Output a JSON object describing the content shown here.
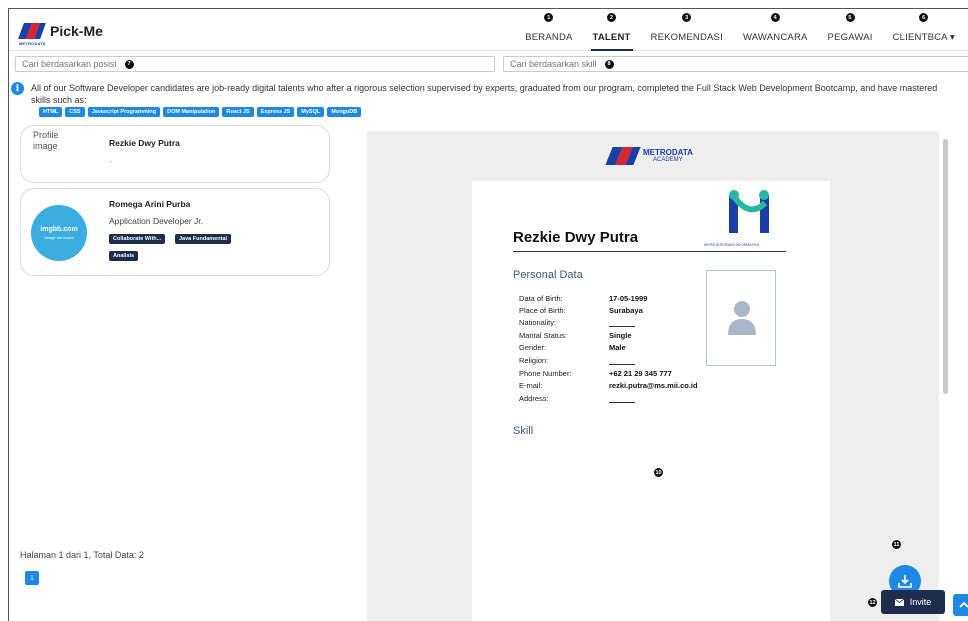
{
  "brand": {
    "name": "Pick-Me",
    "sub": "METRODATA"
  },
  "nav": {
    "items": [
      {
        "num": "1",
        "label": "BERANDA"
      },
      {
        "num": "2",
        "label": "TALENT"
      },
      {
        "num": "3",
        "label": "REKOMENDASI"
      },
      {
        "num": "4",
        "label": "WAWANCARA"
      },
      {
        "num": "5",
        "label": "PEGAWAI"
      },
      {
        "num": "6",
        "label": "CLIENTBCA ▾"
      }
    ]
  },
  "search": {
    "position_placeholder": "Cari berdasarkan posisi",
    "position_num": "7",
    "skill_placeholder": "Cari berdasarkan skill",
    "skill_num": "8"
  },
  "info": {
    "icon": "i",
    "text": "All of our Software Developer candidates are job-ready digital talents who after a rigorous selection supervised by experts, graduated from our program, completed the Full Stack Web Development Bootcamp, and have mastered skills such as:",
    "tags": [
      "HTML",
      "CSS",
      "Javascript Programming",
      "DOM Manipulation",
      "React JS",
      "Express JS",
      "MySQL",
      "MongoDB"
    ]
  },
  "candidates": [
    {
      "image_alt": "Profile image",
      "name": "Rezkie Dwy Putra",
      "role": "-",
      "skills": []
    },
    {
      "image_text": "imgbb.com",
      "image_sub": "Image not found",
      "name": "Romega Arini Purba",
      "role": "Application Developer Jr.",
      "skills": [
        "Collaborate With...",
        "Java Fundamental",
        "Analisis"
      ]
    }
  ],
  "paging": {
    "text": "Halaman 1 dari 1, Total Data: 2",
    "current": "1"
  },
  "markers": {
    "bracket": "9",
    "preview": "10",
    "download": "11",
    "invite": "12"
  },
  "preview": {
    "logo_title": "METRODATA",
    "logo_sub": "ACADEMY",
    "company_caption": "MITRA INTEGRASI INFORMATIKA",
    "cv_name": "Rezkie Dwy Putra",
    "personal_title": "Personal Data",
    "skill_title": "Skill",
    "fields": [
      {
        "k": "Data of Birth:",
        "v": "17-05-1999"
      },
      {
        "k": "Place of Birth:",
        "v": "Surabaya"
      },
      {
        "k": "Nationality:",
        "v": ""
      },
      {
        "k": "Marital Status:",
        "v": "Single"
      },
      {
        "k": "Gender:",
        "v": "Male"
      },
      {
        "k": "Religion:",
        "v": ""
      },
      {
        "k": "Phone Number:",
        "v": "+62 21 29 345 777"
      },
      {
        "k": "E-mail:",
        "v": "rezki.putra@ms.mii.co.id"
      },
      {
        "k": "Address:",
        "v": ""
      }
    ]
  },
  "invite_label": "Invite",
  "colors": {
    "primary": "#1e88e5",
    "navy": "#1e2d4d",
    "brand_blue": "#1a3fa6",
    "brand_red": "#d9262c",
    "teal": "#2bb8a0"
  }
}
